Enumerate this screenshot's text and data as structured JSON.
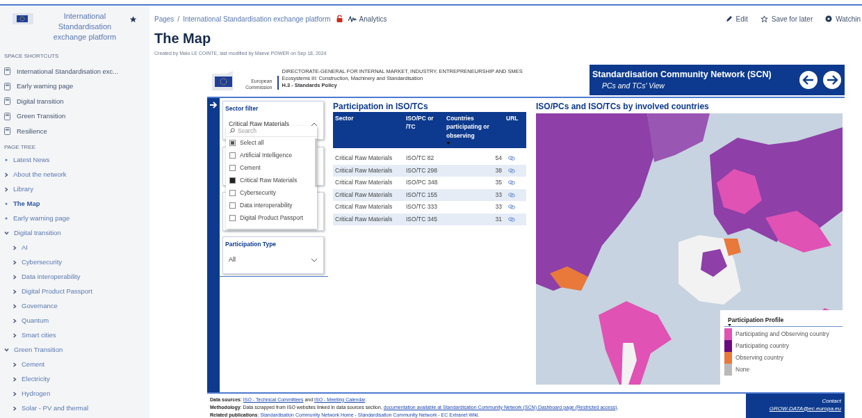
{
  "space": {
    "title": "International Standardisation exchange platform",
    "starred": true
  },
  "shortcuts": {
    "heading": "SPACE SHORTCUTS",
    "items": [
      "International Standardisation exc...",
      "Early warning page",
      "Digital transition",
      "Green Transition",
      "Resilience"
    ]
  },
  "page_tree": {
    "heading": "PAGE TREE",
    "items": [
      {
        "label": "Latest News",
        "selected": false
      },
      {
        "label": "About the network",
        "selected": false,
        "expanded": false
      },
      {
        "label": "Library",
        "selected": false,
        "expanded": false
      },
      {
        "label": "The Map",
        "selected": true
      },
      {
        "label": "Early warning page",
        "selected": false
      },
      {
        "label": "Digital transition",
        "selected": false,
        "expanded": true,
        "children": [
          {
            "label": "AI",
            "selected": false,
            "expanded": false
          },
          {
            "label": "Cybersecurity",
            "selected": false,
            "expanded": false
          },
          {
            "label": "Data interoperability",
            "selected": false,
            "expanded": false
          },
          {
            "label": "Digital Product Passport",
            "selected": false,
            "expanded": false
          },
          {
            "label": "Governance",
            "selected": false,
            "expanded": false
          },
          {
            "label": "Quantum",
            "selected": false,
            "expanded": false
          },
          {
            "label": "Smart cities",
            "selected": false,
            "expanded": false
          }
        ]
      },
      {
        "label": "Green Transition",
        "selected": false,
        "expanded": true,
        "children": [
          {
            "label": "Cement",
            "selected": false,
            "expanded": false
          },
          {
            "label": "Electricity",
            "selected": false,
            "expanded": false
          },
          {
            "label": "Hydrogen",
            "selected": false,
            "expanded": false
          },
          {
            "label": "Solar - PV and thermal",
            "selected": false,
            "expanded": false
          }
        ]
      }
    ]
  },
  "breadcrumb": [
    "Pages",
    "International Standardisation exchange platform"
  ],
  "breadcrumb_separator": "/",
  "analytics": "Analytics",
  "actions": [
    "Edit",
    "Save for later",
    "Watchin"
  ],
  "page_title": "The Map",
  "byline": "Created by Malo LE COINTE, last modified by Maeve POWER on Sep 18, 2024",
  "report": {
    "org": {
      "logo_text": [
        "European",
        "Commission"
      ],
      "lines": [
        "DIRECTORATE-GENERAL FOR INTERNAL MARKET, INDUSTRY, ENTREPRENEURSHIP AND SMES",
        "Ecosystems III: Construction, Machinery and Standardisation",
        "H.3 - Standards Policy"
      ]
    },
    "banner": {
      "title": "Standardisation Community Network (SCN)",
      "subtitle": "PCs and TCs' View"
    },
    "sector_filter": {
      "label": "Sector filter",
      "value": "Critical Raw Materials",
      "open": true,
      "search_placeholder": "Search",
      "options": [
        {
          "label": "Select all",
          "checked": false,
          "partial": true
        },
        {
          "label": "Artificial Intelligence",
          "checked": false,
          "partial": false
        },
        {
          "label": "Cement",
          "checked": false,
          "partial": false
        },
        {
          "label": "Critical Raw Materials",
          "checked": true,
          "partial": false
        },
        {
          "label": "Cybersecurity",
          "checked": false,
          "partial": false
        },
        {
          "label": "Data interoperability",
          "checked": false,
          "partial": false
        },
        {
          "label": "Digital Product Passport",
          "checked": false,
          "partial": false
        }
      ]
    },
    "participation_filter": {
      "label": "Participation Type",
      "value": "All"
    },
    "table": {
      "title": "Participation in ISO/TCs",
      "columns": [
        "Sector",
        "ISO/PC or /TC",
        "Countries participating or observing",
        "URL"
      ],
      "rows": [
        [
          "Critical Raw Materials",
          "ISO/TC 82",
          "54"
        ],
        [
          "Critical Raw Materials",
          "ISO/TC 298",
          "38"
        ],
        [
          "Critical Raw Materials",
          "ISO/PC 348",
          "35"
        ],
        [
          "Critical Raw Materials",
          "ISO/TC 155",
          "33"
        ],
        [
          "Critical Raw Materials",
          "ISO/TC 333",
          "33"
        ],
        [
          "Critical Raw Materials",
          "ISO/TC 345",
          "31"
        ]
      ]
    },
    "map": {
      "title": "ISO/PCs and ISO/TCs by involved countries",
      "legend_title": "Participation Profile",
      "legend": [
        {
          "label": "Participating and Observing country",
          "color": "#e052b4"
        },
        {
          "label": "Participating country",
          "color": "#6b0a80"
        },
        {
          "label": "Observing country",
          "color": "#e8793a"
        },
        {
          "label": "None",
          "color": "#b9b9b9"
        }
      ]
    },
    "footer": {
      "lines": [
        [
          {
            "kind": "label",
            "text": "Data sources"
          },
          {
            "kind": "text",
            "text": ": "
          },
          {
            "kind": "link",
            "text": "ISO - Technical Committees"
          },
          {
            "kind": "text",
            "text": " and "
          },
          {
            "kind": "link",
            "text": "ISO - Meeting Calendar"
          },
          {
            "kind": "text",
            "text": "."
          }
        ],
        [
          {
            "kind": "label",
            "text": "Methodology"
          },
          {
            "kind": "text",
            "text": ": Data scrapped from ISO websites linked in data sources section, "
          },
          {
            "kind": "link",
            "text": "documentation available at Standardisation Community Network (SCN) Dashboard page (Restricted access)"
          },
          {
            "kind": "text",
            "text": "."
          }
        ],
        [
          {
            "kind": "label",
            "text": "Related publications"
          },
          {
            "kind": "text",
            "text": ": "
          },
          {
            "kind": "plainlink",
            "text": "Standardisation Community Network Home - Standardisation Community Network - EC Extranet Wiki"
          },
          {
            "kind": "text",
            "text": "."
          }
        ]
      ],
      "contact_label": "Contact",
      "contact_email": "GROW-DATA@ec.europa.eu"
    }
  }
}
